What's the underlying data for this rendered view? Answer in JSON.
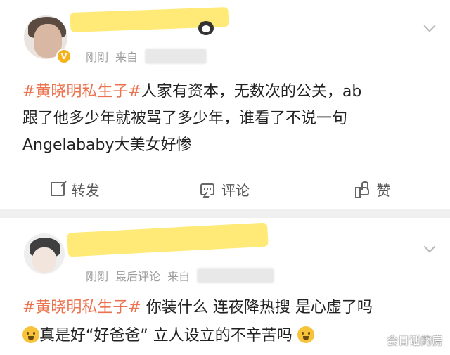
{
  "colors": {
    "hashtag": "#eb7350",
    "meta_text": "#9a9a9a",
    "smear": "#ffe868",
    "verified_badge": "#f5b21b",
    "separator": "#f0f0f0"
  },
  "post1": {
    "username_obscured": "...",
    "verified_badge": "V",
    "time": "刚刚",
    "source_prefix": "来自",
    "hashtag": "#黄晓明私生子#",
    "text_line1": "人家有资本，无数次的公关，ab",
    "text_line2": "跟了他多少年就被骂了多少年，谁看了不说一句",
    "text_line3": "Angelababy大美女好惨",
    "actions": {
      "repost_label": "转发",
      "comment_label": "评论",
      "like_label": "赞"
    },
    "icons": [
      "repost-icon",
      "comment-icon",
      "like-icon",
      "chevron-down-icon"
    ]
  },
  "post2": {
    "time": "刚刚",
    "last_comment": "最后评论",
    "source_prefix": "来自",
    "hashtag": "#黄晓明私生子#",
    "text_line1": "你装什么 连夜降热搜 是心虚了吗",
    "text_line2_a": "真是好“好爸爸” 立人设立的不辛苦吗",
    "emoji1": "scared-face-emoji",
    "emoji2": "thinking-face-emoji"
  },
  "watermark": "会日话的房"
}
